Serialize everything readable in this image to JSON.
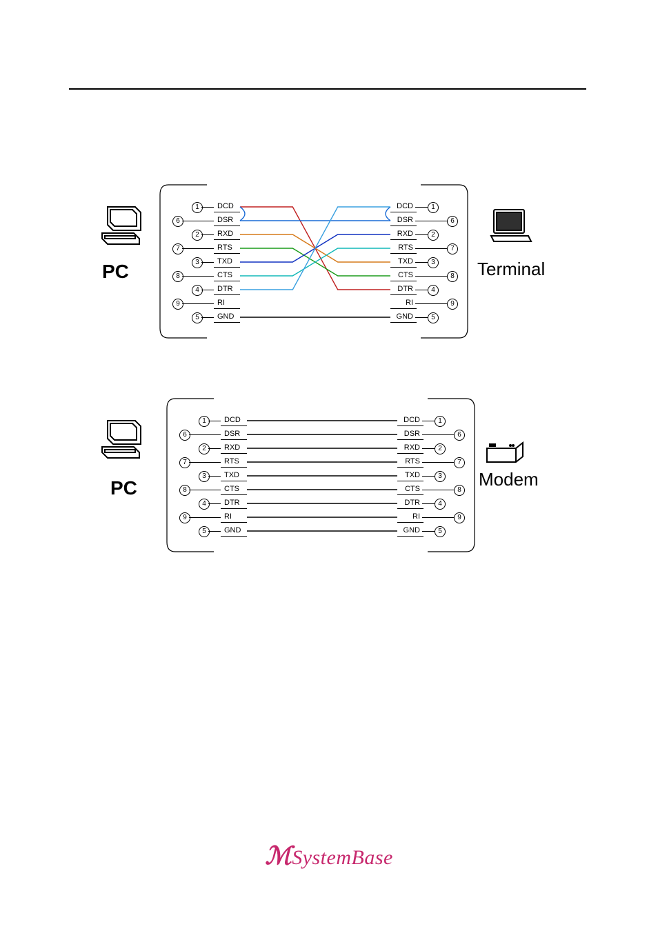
{
  "signals": [
    "DCD",
    "DSR",
    "RXD",
    "RTS",
    "TXD",
    "CTS",
    "DTR",
    "RI",
    "GND"
  ],
  "pin_left": [
    "1",
    "6",
    "2",
    "7",
    "3",
    "8",
    "4",
    "9",
    "5"
  ],
  "pin_right": [
    "1",
    "6",
    "2",
    "7",
    "3",
    "8",
    "4",
    "9",
    "5"
  ],
  "diagram1": {
    "left_device": "PC",
    "right_device": "Terminal",
    "wires": [
      {
        "from": 0,
        "to": 6,
        "color": "#c02020"
      },
      {
        "from": 1,
        "to": 1,
        "color": "#1a6bd6",
        "loop_left": true,
        "loop_right": true
      },
      {
        "from": 2,
        "to": 4,
        "color": "#d67a1a"
      },
      {
        "from": 3,
        "to": 5,
        "color": "#1a9b1a"
      },
      {
        "from": 4,
        "to": 2,
        "color": "#1030c0"
      },
      {
        "from": 5,
        "to": 3,
        "color": "#10b8b8"
      },
      {
        "from": 6,
        "to": 0,
        "color": "#3aa0e0"
      },
      {
        "from": 8,
        "to": 8,
        "color": "#000"
      }
    ]
  },
  "diagram2": {
    "left_device": "PC",
    "right_device": "Modem",
    "wires": [
      {
        "from": 0,
        "to": 0,
        "color": "#000"
      },
      {
        "from": 1,
        "to": 1,
        "color": "#000"
      },
      {
        "from": 2,
        "to": 2,
        "color": "#000"
      },
      {
        "from": 3,
        "to": 3,
        "color": "#000"
      },
      {
        "from": 4,
        "to": 4,
        "color": "#000"
      },
      {
        "from": 5,
        "to": 5,
        "color": "#000"
      },
      {
        "from": 6,
        "to": 6,
        "color": "#000"
      },
      {
        "from": 7,
        "to": 7,
        "color": "#000"
      },
      {
        "from": 8,
        "to": 8,
        "color": "#000"
      }
    ]
  },
  "footer": {
    "brand": "SystemBase"
  }
}
